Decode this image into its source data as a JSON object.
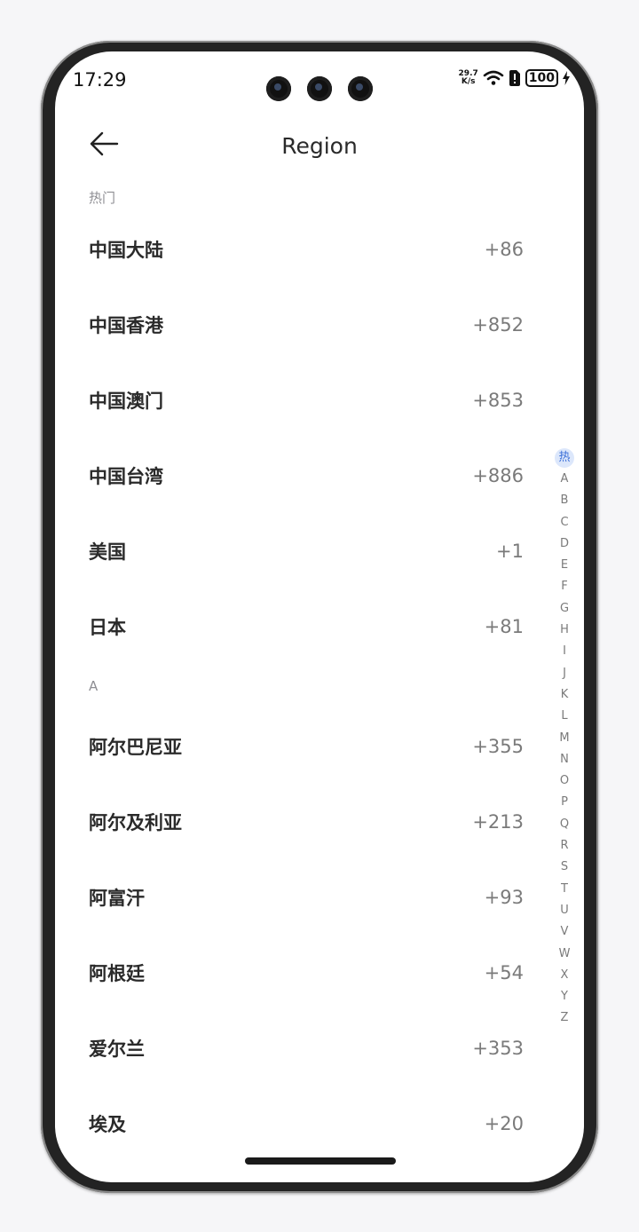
{
  "status": {
    "time": "17:29",
    "net_speed_value": "29.7",
    "net_speed_unit": "K/s",
    "battery": "100"
  },
  "header": {
    "title": "Region"
  },
  "sections": [
    {
      "header": "热门",
      "items": [
        {
          "name": "中国大陆",
          "code": "+86"
        },
        {
          "name": "中国香港",
          "code": "+852"
        },
        {
          "name": "中国澳门",
          "code": "+853"
        },
        {
          "name": "中国台湾",
          "code": "+886"
        },
        {
          "name": "美国",
          "code": "+1"
        },
        {
          "name": "日本",
          "code": "+81"
        }
      ]
    },
    {
      "header": "A",
      "items": [
        {
          "name": "阿尔巴尼亚",
          "code": "+355"
        },
        {
          "name": "阿尔及利亚",
          "code": "+213"
        },
        {
          "name": "阿富汗",
          "code": "+93"
        },
        {
          "name": "阿根廷",
          "code": "+54"
        },
        {
          "name": "爱尔兰",
          "code": "+353"
        },
        {
          "name": "埃及",
          "code": "+20"
        }
      ]
    }
  ],
  "index_bar": [
    "热",
    "A",
    "B",
    "C",
    "D",
    "E",
    "F",
    "G",
    "H",
    "I",
    "J",
    "K",
    "L",
    "M",
    "N",
    "O",
    "P",
    "Q",
    "R",
    "S",
    "T",
    "U",
    "V",
    "W",
    "X",
    "Y",
    "Z"
  ],
  "index_active": "热",
  "colors": {
    "accent": "#3b6fd8",
    "active_index_bg": "#dce7fb"
  }
}
